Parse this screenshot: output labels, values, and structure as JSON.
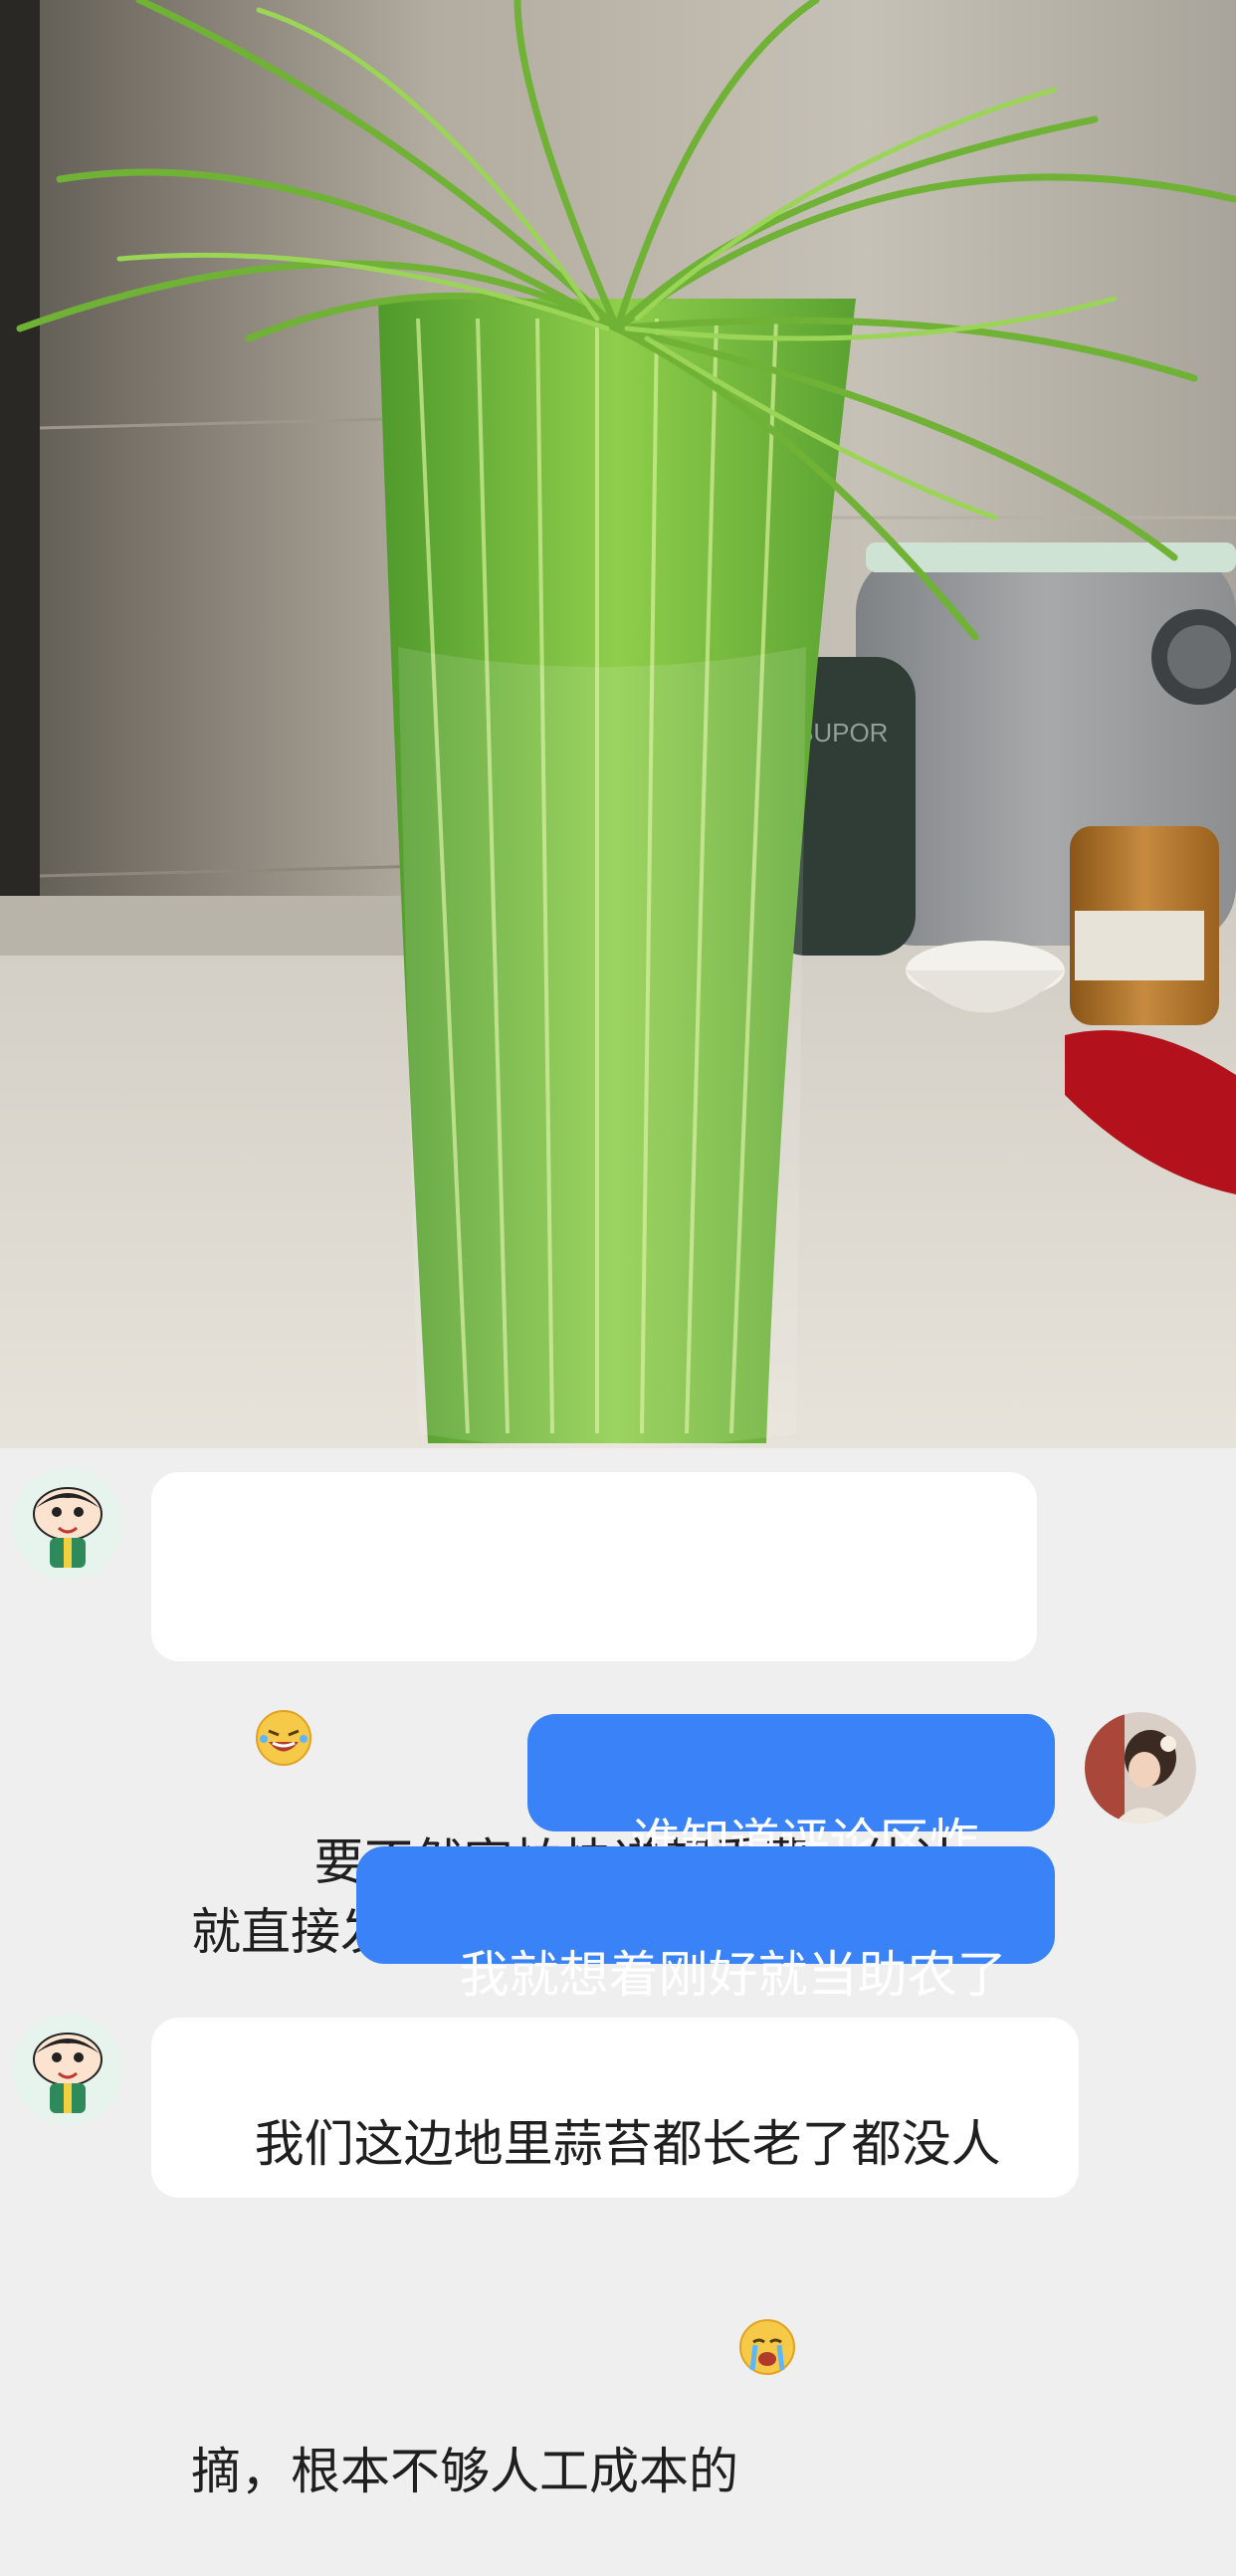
{
  "photo": {
    "icon": "garlic-scape-bundle-photo",
    "appliance_brand": "SUPOR"
  },
  "messages": [
    {
      "side": "left",
      "avatar": "cartoon-boy-avatar",
      "emoji": "laughing-crying-emoji",
      "text": "要不然害怕快递超重费，估计就直接发五十斤了，"
    },
    {
      "side": "right",
      "avatar": "girl-photo-avatar",
      "text": "谁知道评论区炸了"
    },
    {
      "side": "right",
      "text": "我就想着刚好就当助农了"
    },
    {
      "side": "left",
      "avatar": "cartoon-boy-avatar",
      "emoji": "crying-emoji",
      "text": "我们这边地里蒜苔都长老了都没人摘，根本不够人工成本的"
    }
  ],
  "colors": {
    "chat_background": "#efefef",
    "left_bubble": "#ffffff",
    "right_bubble": "#3a82f7"
  }
}
